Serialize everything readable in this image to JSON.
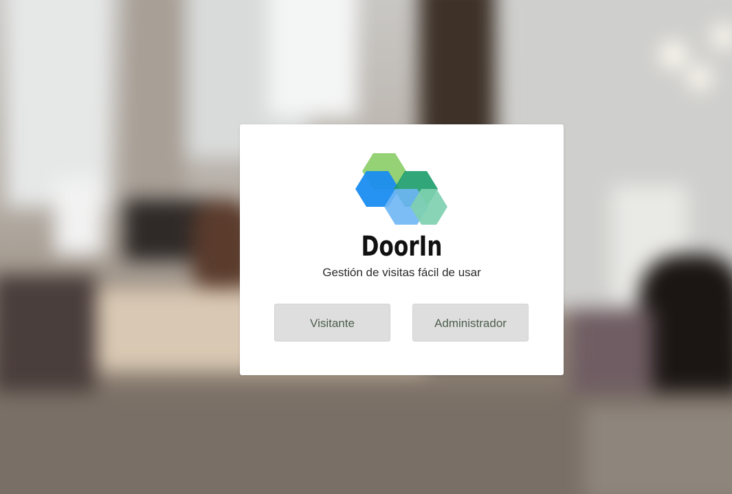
{
  "app": {
    "brand_name": "DoorIn",
    "tagline": "Gestión de visitas fácil de usar"
  },
  "actions": {
    "visitor_label": "Visitante",
    "admin_label": "Administrador"
  },
  "colors": {
    "card_background": "#ffffff",
    "button_background": "#dedede",
    "button_text": "#4d5e4d",
    "logo_light_green": "#8fcf6e",
    "logo_dark_green": "#1e9e6e",
    "logo_blue": "#1a8cf0",
    "logo_light_blue": "#6fb6f5",
    "logo_mint": "#7fd0b0"
  }
}
